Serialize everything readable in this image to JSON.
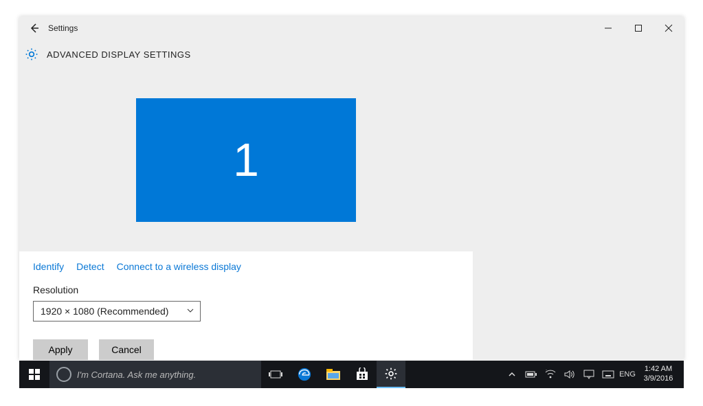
{
  "titlebar": {
    "back_icon": "←",
    "title": "Settings"
  },
  "header": {
    "page_title": "ADVANCED DISPLAY SETTINGS"
  },
  "display": {
    "monitor_number": "1"
  },
  "links": {
    "identify": "Identify",
    "detect": "Detect",
    "connect": "Connect to a wireless display"
  },
  "resolution": {
    "label": "Resolution",
    "value": "1920 × 1080 (Recommended)"
  },
  "buttons": {
    "apply": "Apply",
    "cancel": "Cancel"
  },
  "search": {
    "placeholder": "I'm Cortana. Ask me anything."
  },
  "tray": {
    "lang": "ENG"
  },
  "clock": {
    "time": "1:42 AM",
    "date": "3/9/2016"
  }
}
